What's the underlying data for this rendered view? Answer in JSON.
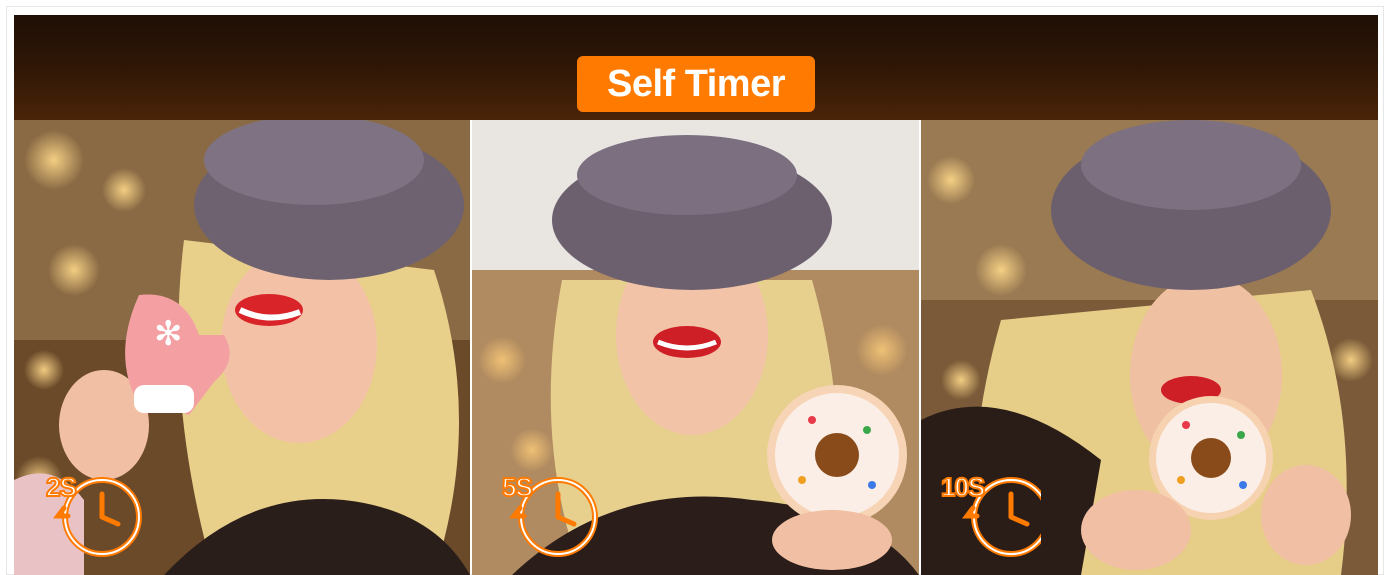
{
  "header": {
    "title": "Self Timer"
  },
  "colors": {
    "accent": "#ff7a00",
    "banner_dark": "#2d1606"
  },
  "photos": [
    {
      "timer_label": "2S",
      "icon": "stopwatch-icon",
      "prop": "mitten-cookie"
    },
    {
      "timer_label": "5S",
      "icon": "stopwatch-icon",
      "prop": "donut"
    },
    {
      "timer_label": "10S",
      "icon": "stopwatch-icon",
      "prop": "donut"
    }
  ]
}
